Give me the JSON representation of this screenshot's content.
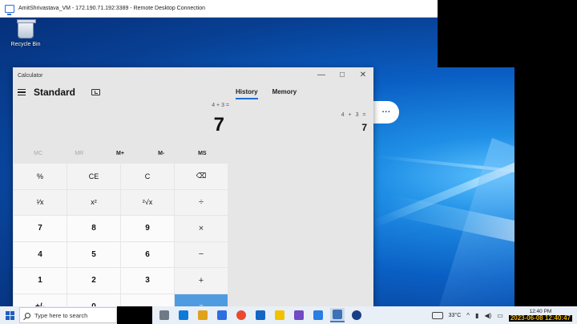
{
  "rdp": {
    "title": "AmitShrivastava_VM - 172.190.71.192:3389 - Remote Desktop Connection"
  },
  "desktop": {
    "recycle_bin_label": "Recycle Bin",
    "pill_label": "···"
  },
  "calculator": {
    "window_title": "Calculator",
    "minimize": "—",
    "maximize": "□",
    "close": "✕",
    "mode": "Standard",
    "expression": "4 + 3 =",
    "display": "7",
    "memory_buttons": [
      {
        "label": "MC",
        "enabled": false
      },
      {
        "label": "MR",
        "enabled": false
      },
      {
        "label": "M+",
        "enabled": true
      },
      {
        "label": "M-",
        "enabled": true
      },
      {
        "label": "MS",
        "enabled": true
      }
    ],
    "keys": [
      "%",
      "CE",
      "C",
      "⌫",
      "¹⁄x",
      "x²",
      "²√x",
      "÷",
      "7",
      "8",
      "9",
      "×",
      "4",
      "5",
      "6",
      "−",
      "1",
      "2",
      "3",
      "+",
      "+/-",
      "0",
      ".",
      "="
    ],
    "tabs": {
      "history": "History",
      "memory": "Memory"
    },
    "history": {
      "expression": "4  +  3 =",
      "result": "7"
    }
  },
  "taskbar": {
    "search_placeholder": "Type here to search",
    "temperature": "33°C",
    "time": "12:40 PM",
    "date": "2023-06-08 12:40:47",
    "app_colors": [
      "#6f7a86",
      "#0f7bd8",
      "#e0a21a",
      "#2f6ee0",
      "#e94a2f",
      "#1366c4",
      "#f2c200",
      "#6f4cc3",
      "#2a7de1",
      "#3e72b8",
      "#1b3f86"
    ]
  }
}
